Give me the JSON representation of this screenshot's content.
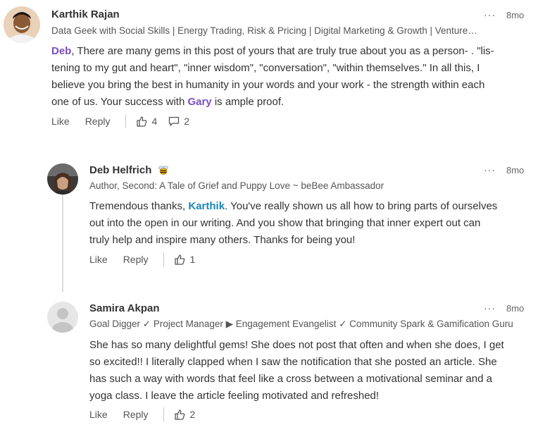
{
  "comments": [
    {
      "author": "Karthik Rajan",
      "headline": "Data Geek with Social Skills | Energy Trading, Risk & Pricing | Digital Marketing & Growth | Venture…",
      "time": "8mo",
      "more": "···",
      "body": {
        "mention1": "Deb",
        "line1_rest": ", There are many gems in this post of yours that are truly true about you as a person- . \"lis-",
        "line2": "tening to my gut and heart\", \"inner wisdom\", \"conversation\", \"within themselves.\" In all this, I",
        "line3": "believe you bring the best in humanity in your words and your work - the strength within each",
        "line4_pre": "one of us. Your success with ",
        "mention2": "Gary",
        "line4_post": " is ample proof."
      },
      "like_label": "Like",
      "reply_label": "Reply",
      "likes": "4",
      "replies": "2"
    },
    {
      "author": "Deb Helfrich",
      "headline": "Author, Second: A Tale of Grief and Puppy Love ~ beBee Ambassador",
      "time": "8mo",
      "more": "···",
      "body": {
        "line1_pre": "Tremendous thanks, ",
        "mention": "Karthik",
        "line1_post": ". You've really shown us all how to bring parts of ourselves",
        "line2": "out into the open in our writing. And you show that bringing that inner expert out can",
        "line3": "truly help and inspire many others. Thanks for being you!"
      },
      "like_label": "Like",
      "reply_label": "Reply",
      "likes": "1"
    },
    {
      "author": "Samira Akpan",
      "headline": "Goal Digger ✓ Project Manager ▶ Engagement Evangelist ✓ Community Spark & Gamification Guru",
      "time": "8mo",
      "more": "···",
      "body": {
        "line1": "She has so many delightful gems! She does not post that often and when she does, I get",
        "line2": "so excited!! I literally clapped when I saw the notification that she posted an article. She",
        "line3": "has such a way with words that feel like a cross between a motivational seminar and a",
        "line4": "yoga class. I leave the article feeling motivated and refreshed!"
      },
      "like_label": "Like",
      "reply_label": "Reply",
      "likes": "2"
    }
  ],
  "colors": {
    "mention_purple": "#7b4fc2",
    "mention_teal": "#1a86b6",
    "text": "#333333",
    "muted": "#555555"
  },
  "icons": [
    "thumbs-up-icon",
    "comment-icon",
    "bee-icon",
    "more-icon"
  ]
}
